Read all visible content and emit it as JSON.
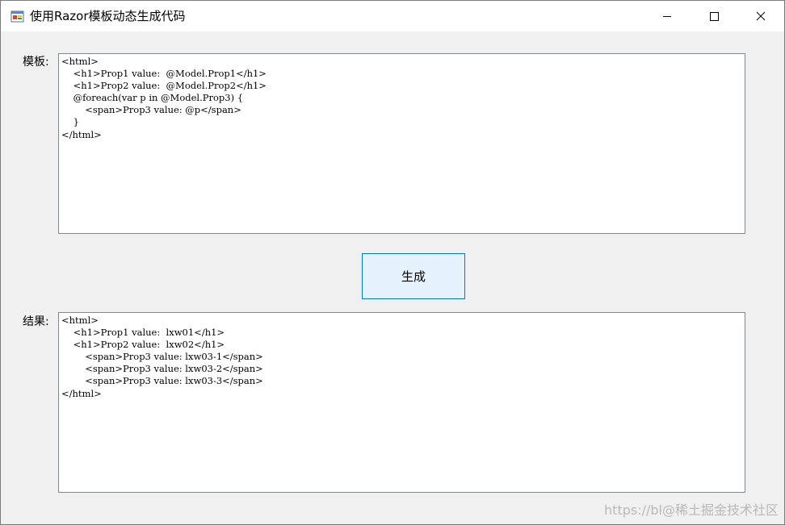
{
  "window": {
    "title": "使用Razor模板动态生成代码"
  },
  "form": {
    "template_label": "模板:",
    "template_text": "<html>\n    <h1>Prop1 value:  @Model.Prop1</h1>\n    <h1>Prop2 value:  @Model.Prop2</h1>\n    @foreach(var p in @Model.Prop3) {\n        <span>Prop3 value: @p</span>\n    }\n</html>",
    "generate_label": "生成",
    "result_label": "结果:",
    "result_text": "<html>\n    <h1>Prop1 value:  lxw01</h1>\n    <h1>Prop2 value:  lxw02</h1>\n        <span>Prop3 value: lxw03-1</span>\n        <span>Prop3 value: lxw03-2</span>\n        <span>Prop3 value: lxw03-3</span>\n</html>"
  },
  "watermark": {
    "text": "https://bl@稀土掘金技术社区"
  },
  "icons": {
    "app": "windows-form-icon",
    "minimize": "minimize-icon",
    "maximize": "maximize-icon",
    "close": "close-icon"
  },
  "colors": {
    "accent_border": "#0078d7",
    "button_fill": "#e5f1fb",
    "form_background": "#f0f0f0",
    "titlebar_background": "#ffffff"
  }
}
